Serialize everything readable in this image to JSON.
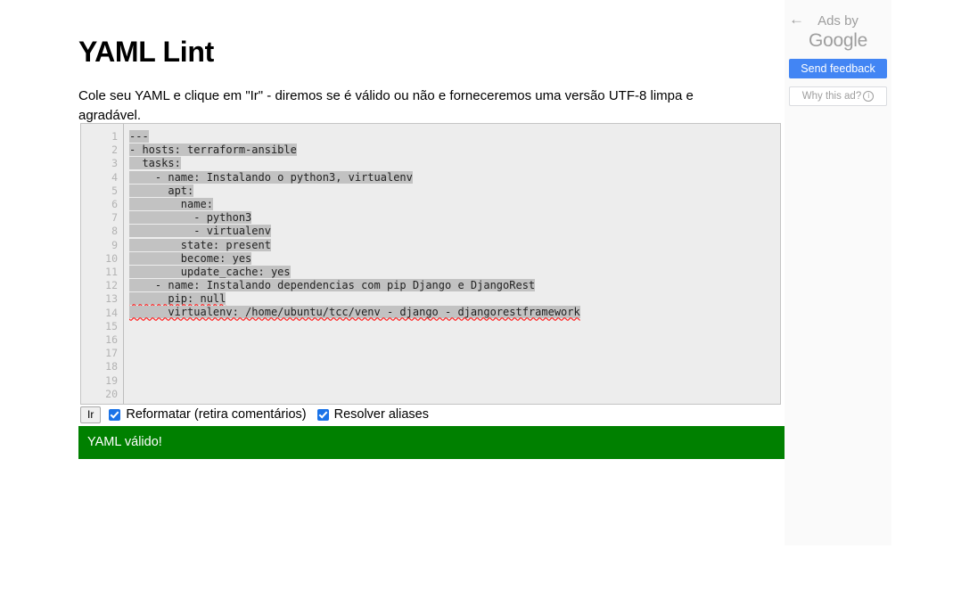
{
  "page": {
    "title": "YAML Lint",
    "intro": "Cole seu YAML e clique em \"Ir\" - diremos se é válido ou não e forneceremos uma versão UTF-8 limpa e agradável."
  },
  "editor": {
    "total_lines": 20,
    "line_numbers": [
      "1",
      "2",
      "3",
      "4",
      "5",
      "6",
      "7",
      "8",
      "9",
      "10",
      "11",
      "12",
      "13",
      "14",
      "15",
      "16",
      "17",
      "18",
      "19",
      "20"
    ],
    "lines": [
      "---",
      "- hosts: terraform-ansible",
      "  tasks:",
      "    - name: Instalando o python3, virtualenv",
      "      apt:",
      "        name:",
      "          - python3",
      "          - virtualenv",
      "        state: present",
      "        become: yes",
      "        update_cache: yes",
      "    - name: Instalando dependencias com pip Django e DjangoRest",
      "      pip: null",
      "      virtualenv: /home/ubuntu/tcc/venv - django - djangorestframework",
      "",
      "",
      "",
      "",
      "",
      ""
    ],
    "spellchecked_lines": [
      13,
      14
    ],
    "selection_color": "#c2c2c2",
    "background_color": "#ededed",
    "gutter_color": "#ededed"
  },
  "controls": {
    "go_button_label": "Ir",
    "checkbox_reformat": {
      "label": "Reformatar (retira comentários)",
      "checked": true
    },
    "checkbox_aliases": {
      "label": "Resolver aliases",
      "checked": true
    },
    "checkbox_color": "#1a73e8"
  },
  "status": {
    "text": "YAML válido!",
    "background_color": "#008000",
    "text_color": "#ffffff"
  },
  "ad_panel": {
    "back_arrow_icon": "back-arrow-icon",
    "ads_by_label": "Ads by",
    "google_label": "Google",
    "send_feedback_label": "Send feedback",
    "why_this_ad_label": "Why this ad?",
    "info_icon_glyph": "i",
    "button_color": "#4285f4",
    "panel_background": "#fafafa"
  }
}
